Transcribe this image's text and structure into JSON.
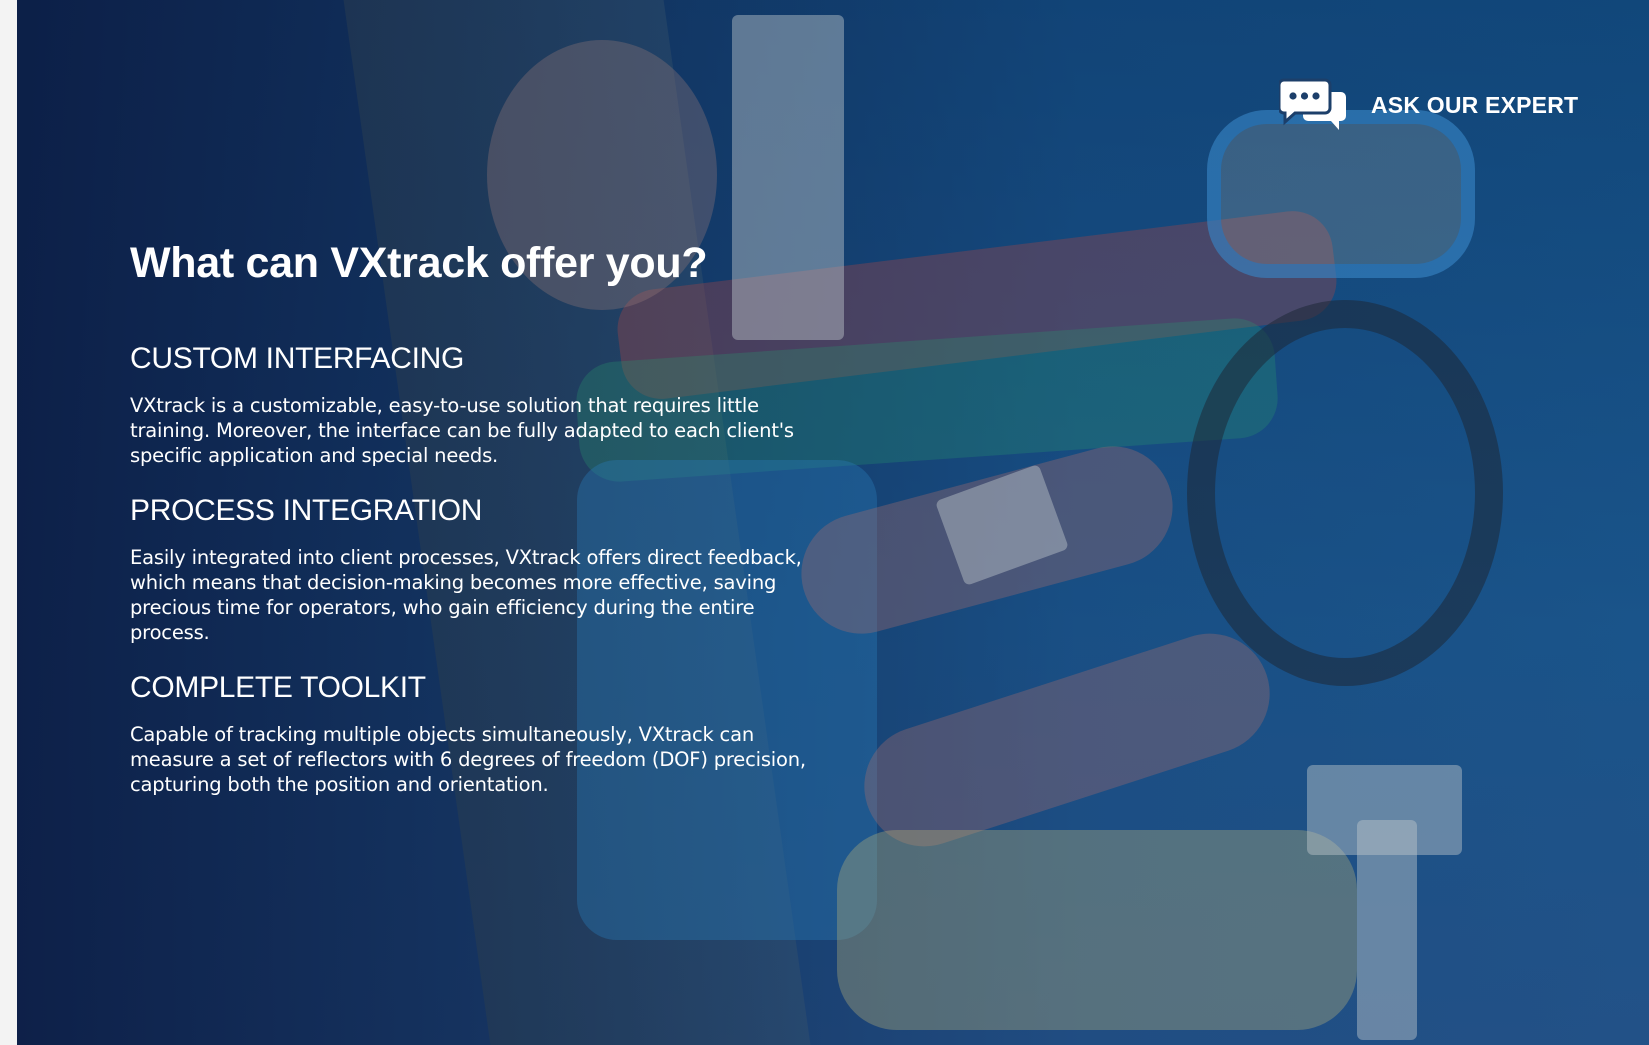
{
  "header": {
    "expert_button": {
      "label": "ASK OUR EXPERT",
      "icon": "chat-bubbles-icon"
    }
  },
  "main": {
    "title": "What can VXtrack offer you?",
    "sections": [
      {
        "heading": "CUSTOM INTERFACING",
        "text": "VXtrack is a customizable, easy-to-use solution that requires little training. Moreover, the interface can be fully adapted to each client's specific application and special needs."
      },
      {
        "heading": "PROCESS INTEGRATION",
        "text": "Easily integrated into client processes, VXtrack offers direct feedback, which means that decision-making becomes more effective, saving precious time for operators, who gain efficiency during the entire process."
      },
      {
        "heading": "COMPLETE TOOLKIT",
        "text": "Capable of tracking multiple objects simultaneously, VXtrack can measure a set of reflectors with 6 degrees of freedom (DOF) precision, capturing both the position and orientation."
      }
    ]
  },
  "colors": {
    "overlay": "#0f2a55",
    "text": "#ffffff",
    "page_edge": "#f3f3f3"
  }
}
